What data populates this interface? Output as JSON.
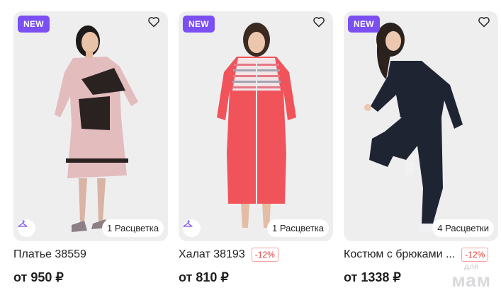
{
  "products": [
    {
      "badge": "NEW",
      "colors_label": "1 Расцветка",
      "title": "Платье 38559",
      "discount": "",
      "price": "от 950 ₽",
      "icons": [
        "heart-icon",
        "hanger-icon"
      ]
    },
    {
      "badge": "NEW",
      "colors_label": "1 Расцветка",
      "title": "Халат 38193",
      "discount": "-12%",
      "price": "от 810 ₽",
      "icons": [
        "heart-icon",
        "hanger-icon"
      ]
    },
    {
      "badge": "NEW",
      "colors_label": "4 Расцветки",
      "title": "Костюм с брюками ...",
      "discount": "-12%",
      "price": "от 1338 ₽",
      "icons": [
        "heart-icon"
      ]
    }
  ],
  "watermark": {
    "line1": "для",
    "line2": "мам"
  },
  "colors": {
    "badge": "#7b4ff2",
    "discount": "#e53935",
    "photo_bg": "#eeeeef"
  }
}
